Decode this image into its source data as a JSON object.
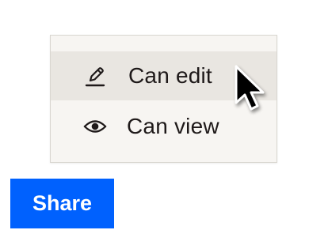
{
  "permission_menu": {
    "items": [
      {
        "label": "Can edit",
        "icon": "pencil-icon",
        "highlighted": true
      },
      {
        "label": "Can view",
        "icon": "eye-icon",
        "highlighted": false
      }
    ]
  },
  "share_button": {
    "label": "Share",
    "color": "#0061fe",
    "text_color": "#ffffff"
  },
  "colors": {
    "menu_background": "#f7f5f2",
    "menu_highlight": "#e9e6e1",
    "menu_border": "#d9d6d0",
    "text": "#1e1919"
  }
}
